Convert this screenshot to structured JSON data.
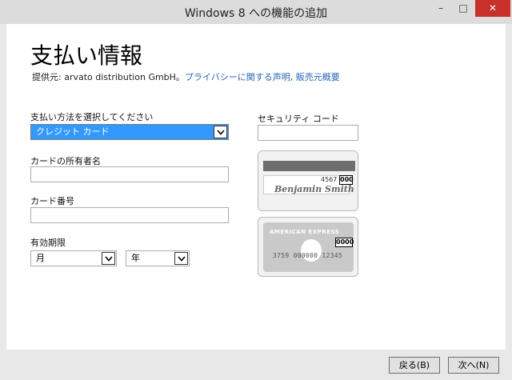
{
  "window": {
    "title": "Windows 8 への機能の追加",
    "minimize": "–",
    "maximize": "□",
    "close": "✕"
  },
  "page": {
    "heading": "支払い情報",
    "provider_prefix": "提供元: arvato distribution GmbH。",
    "privacy_link": "プライバシーに関する声明",
    "separator": ", ",
    "seller_link": "販売元概要"
  },
  "form": {
    "payment_method_label": "支払い方法を選択してください",
    "payment_method_value": "クレジット カード",
    "cardholder_label": "カードの所有者名",
    "cardholder_value": "",
    "card_number_label": "カード番号",
    "card_number_value": "",
    "expiry_label": "有効期限",
    "month_value": "月",
    "year_value": "年",
    "security_code_label": "セキュリティ コード",
    "security_code_value": ""
  },
  "cards": {
    "back_number": "4567",
    "back_code": "000",
    "back_name": "Benjamin Smith",
    "amex_title": "AMERICAN EXPRESS",
    "amex_code": "0000",
    "amex_number": "3759 000000 12345"
  },
  "buttons": {
    "back": "戻る(B)",
    "next": "次へ(N)"
  },
  "colors": {
    "link": "#2a64b6",
    "selection": "#3399ff",
    "close_button": "#c7302b"
  }
}
